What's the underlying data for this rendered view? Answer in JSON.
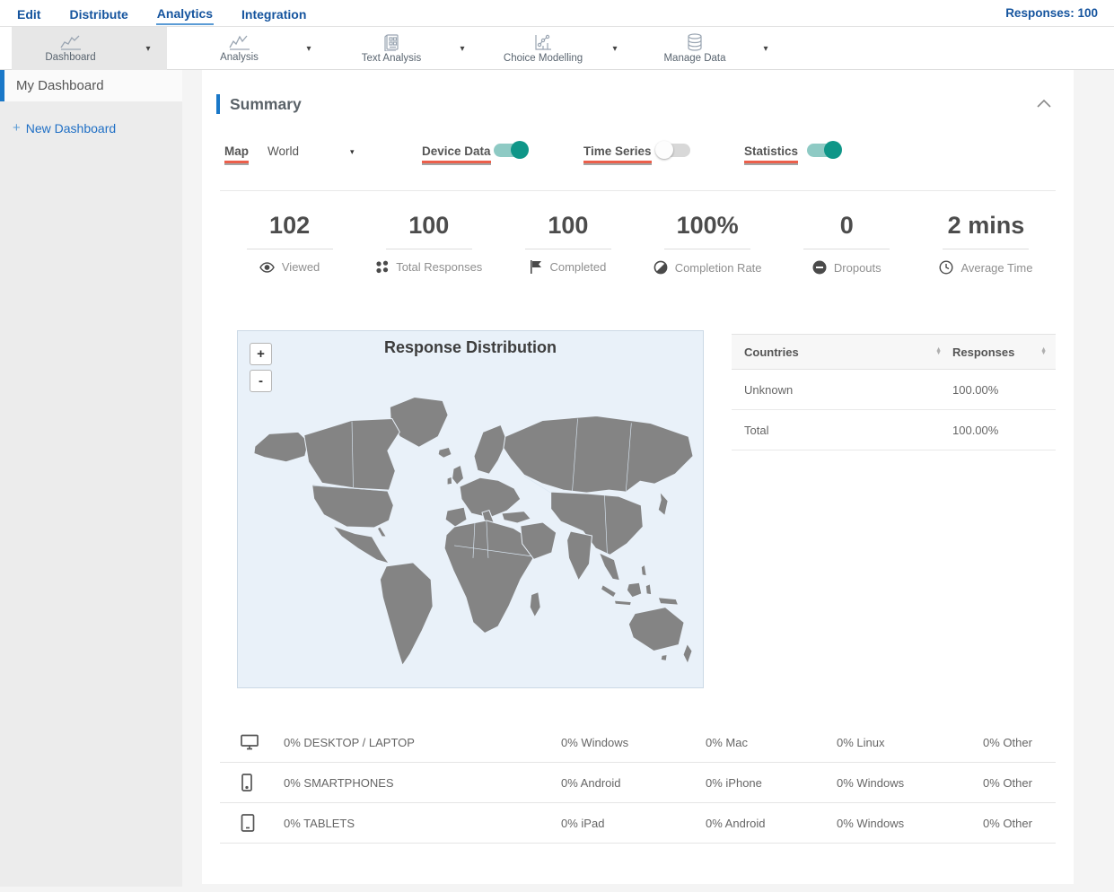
{
  "topnav": {
    "items": [
      "Edit",
      "Distribute",
      "Analytics",
      "Integration"
    ],
    "active_item": "Analytics",
    "responses_label": "Responses: 100"
  },
  "toolbar": {
    "items": [
      {
        "label": "Dashboard",
        "icon": "line-chart-icon",
        "active": true
      },
      {
        "label": "Analysis",
        "icon": "line-chart-icon",
        "active": false
      },
      {
        "label": "Text Analysis",
        "icon": "document-grid-icon",
        "active": false
      },
      {
        "label": "Choice Modelling",
        "icon": "scatter-chart-icon",
        "active": false
      },
      {
        "label": "Manage Data",
        "icon": "database-icon",
        "active": false
      }
    ],
    "caret": "▾"
  },
  "sidebar": {
    "current_dashboard": "My Dashboard",
    "new_dashboard": {
      "plus": "+",
      "label": "New Dashboard"
    }
  },
  "summary": {
    "title": "Summary",
    "collapse_icon": "chevron-up-icon"
  },
  "controls": {
    "map_label": "Map",
    "map_value": "World",
    "dropdown_caret": "▾",
    "toggles": [
      {
        "label": "Device Data",
        "state": "on"
      },
      {
        "label": "Time Series",
        "state": "off"
      },
      {
        "label": "Statistics",
        "state": "on"
      }
    ],
    "underline_color": "#ec5f4b",
    "toggle_on_color": "#0f9688"
  },
  "stats": [
    {
      "value": "102",
      "label": "Viewed",
      "icon": "eye-icon"
    },
    {
      "value": "100",
      "label": "Total Responses",
      "icon": "four-dots-icon"
    },
    {
      "value": "100",
      "label": "Completed",
      "icon": "flag-icon"
    },
    {
      "value": "100%",
      "label": "Completion Rate",
      "icon": "half-circle-icon"
    },
    {
      "value": "0",
      "label": "Dropouts",
      "icon": "minus-circle-icon"
    },
    {
      "value": "2 mins",
      "label": "Average Time",
      "icon": "clock-icon"
    }
  ],
  "map": {
    "title": "Response Distribution",
    "zoom_in": "+",
    "zoom_out": "-",
    "land_color": "#848484",
    "sea_color": "#e9f1f9"
  },
  "countries_table": {
    "headers": {
      "col1": "Countries",
      "col2": "Responses"
    },
    "rows": [
      {
        "country": "Unknown",
        "responses": "100.00%"
      },
      {
        "country": "Total",
        "responses": "100.00%"
      }
    ]
  },
  "device_table": {
    "rows": [
      {
        "icon": "desktop-icon",
        "category": "0% DESKTOP / LAPTOP",
        "cells": [
          "0% Windows",
          "0% Mac",
          "0% Linux",
          "0% Other"
        ]
      },
      {
        "icon": "smartphone-icon",
        "category": "0% SMARTPHONES",
        "cells": [
          "0% Android",
          "0% iPhone",
          "0% Windows",
          "0% Other"
        ]
      },
      {
        "icon": "tablet-icon",
        "category": "0% TABLETS",
        "cells": [
          "0% iPad",
          "0% Android",
          "0% Windows",
          "0% Other"
        ]
      }
    ]
  }
}
